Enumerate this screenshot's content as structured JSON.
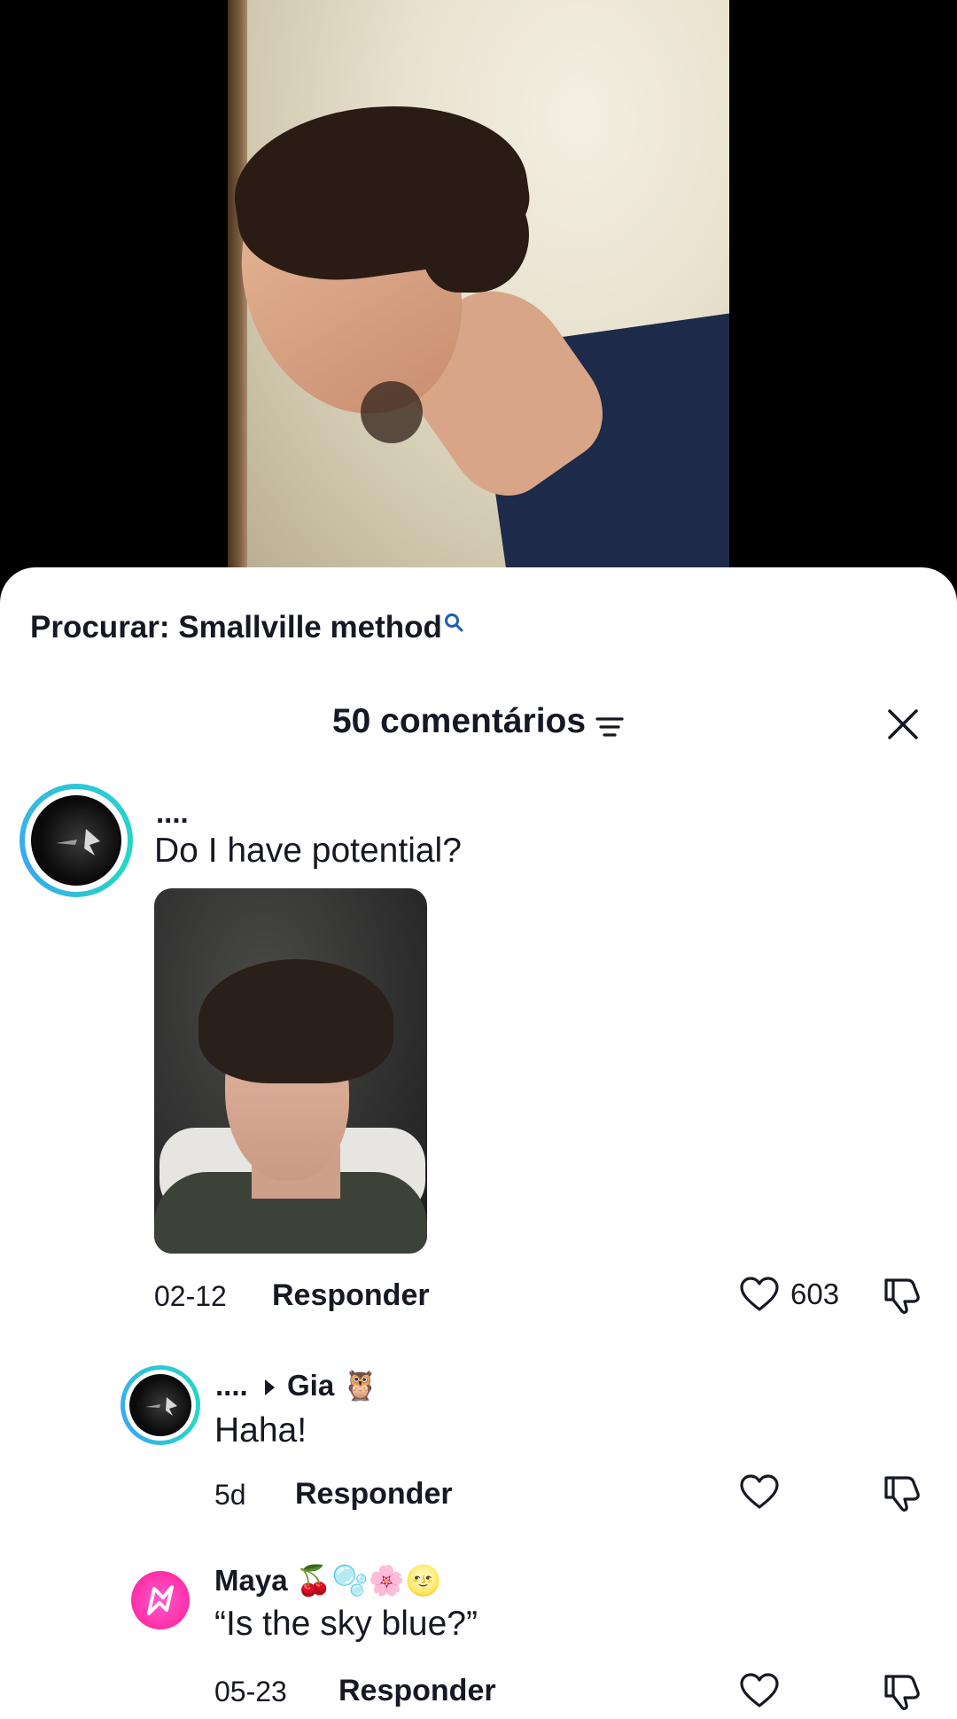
{
  "video": {
    "description_hidden": true
  },
  "search_hint": {
    "prefix": "Procurar: Smallville method"
  },
  "comments_header": {
    "title": "50 comentários"
  },
  "comments": [
    {
      "username": "....",
      "text": "Do I have potential?",
      "date": "02-12",
      "reply_label": "Responder",
      "likes": "603"
    }
  ],
  "replies": [
    {
      "username": "....",
      "reply_to": "Gia 🦉",
      "text": "Haha!",
      "date": "5d",
      "reply_label": "Responder"
    },
    {
      "username": "Maya 🍒🫧🌸🌝",
      "text": "“Is the sky blue?”",
      "date": "05-23",
      "reply_label": "Responder"
    }
  ],
  "colors": {
    "accent_ring": "#2ec7d8",
    "search_icon": "#1a5fb4",
    "text": "#161823"
  }
}
